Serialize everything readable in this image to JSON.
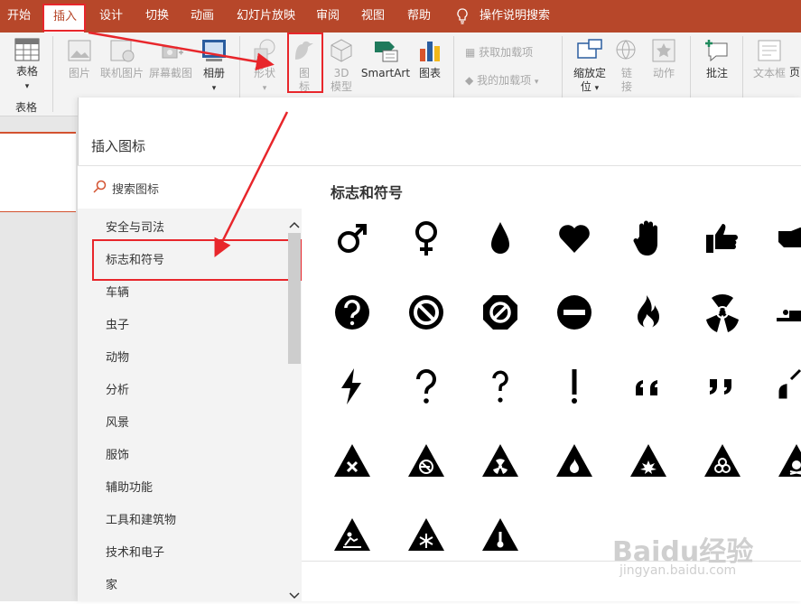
{
  "menu": {
    "tabs": [
      "开始",
      "插入",
      "设计",
      "切换",
      "动画",
      "幻灯片放映",
      "审阅",
      "视图",
      "帮助"
    ],
    "tell_me": "操作说明搜索"
  },
  "ribbon": {
    "table": "表格",
    "table_group": "表格",
    "picture": "图片",
    "online_picture": "联机图片",
    "screenshot": "屏幕截图",
    "album": "相册",
    "shapes": "形状",
    "icons_line1": "图",
    "icons_line2": "标",
    "model_line1": "3D",
    "model_line2": "模型",
    "smartart": "SmartArt",
    "chart": "图表",
    "get_addins": "获取加载项",
    "my_addins": "我的加载项",
    "zoom_line1": "缩放定",
    "zoom_line2": "位",
    "link_line1": "链",
    "link_line2": "接",
    "action": "动作",
    "comment": "批注",
    "textbox": "文本框",
    "more": "页"
  },
  "dialog": {
    "title": "插入图标",
    "search_placeholder": "搜索图标",
    "section_title": "标志和符号",
    "categories": [
      "安全与司法",
      "标志和符号",
      "车辆",
      "虫子",
      "动物",
      "分析",
      "风景",
      "服饰",
      "辅助功能",
      "工具和建筑物",
      "技术和电子",
      "家"
    ],
    "selected_category": "标志和符号"
  },
  "icons": [
    [
      "male-symbol",
      "female-symbol",
      "water-drop",
      "heart",
      "stop-hand",
      "thumbs-up",
      "hand-pointing"
    ],
    [
      "question-circle",
      "prohibited-circle",
      "prohibited-octagon",
      "no-entry",
      "fire",
      "radiation",
      "person-sitting"
    ],
    [
      "lightning",
      "question-mark",
      "question-mark-narrow",
      "exclamation",
      "open-quote",
      "close-quote",
      "quote-partial"
    ],
    [
      "warning-x",
      "warning-no-smoking",
      "warning-radiation",
      "warning-fire",
      "warning-explosion",
      "warning-biohazard",
      "warning-poison"
    ],
    [
      "warning-slippery",
      "warning-cold",
      "warning-temperature"
    ]
  ],
  "watermark": {
    "main": "Baidu经验",
    "sub": "jingyan.baidu.com"
  }
}
